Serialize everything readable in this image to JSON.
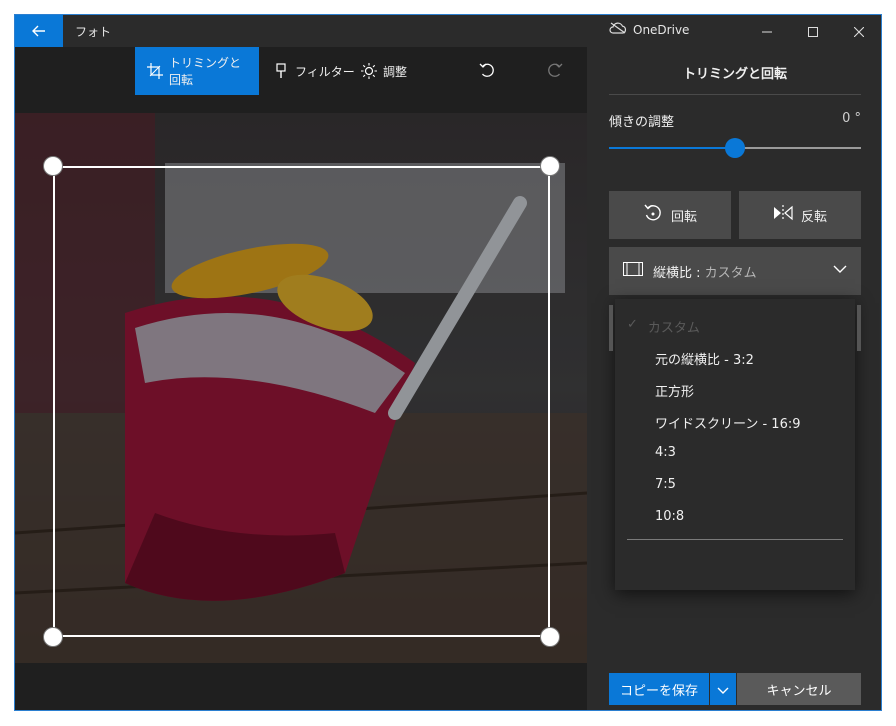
{
  "window": {
    "app_title": "フォト",
    "onedrive_label": "OneDrive",
    "icons": {
      "back": "back-arrow-icon",
      "cloud": "cloud-icon",
      "minimize": "minimize-icon",
      "maximize": "maximize-icon",
      "close": "close-icon"
    }
  },
  "toolbar": {
    "crop_label": "トリミングと回転",
    "filter_label": "フィルター",
    "adjust_label": "調整",
    "undo_icon": "undo-icon",
    "redo_icon": "redo-icon",
    "accent": "#0a78d7"
  },
  "panel": {
    "title": "トリミングと回転",
    "tilt_label": "傾きの調整",
    "tilt_value": "0 °",
    "tilt_slider_fraction": 0.5,
    "rotate_label": "回転",
    "flip_label": "反転",
    "aspect_label": "縦横比 :",
    "aspect_value": "カスタム",
    "save_label": "コピーを保存",
    "cancel_label": "キャンセル"
  },
  "aspect_options": {
    "custom": "カスタム",
    "original": "元の縦横比 - 3:2",
    "square": "正方形",
    "widescreen": "ワイドスクリーン - 16:9",
    "r43": "4:3",
    "r75": "7:5",
    "r108": "10:8"
  }
}
